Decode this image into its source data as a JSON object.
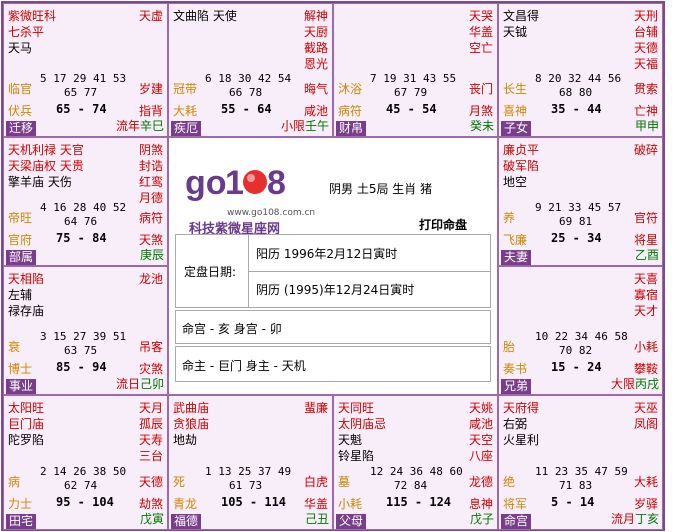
{
  "chart": {
    "title": "打印命盘",
    "gender_info": "阴男  土5局  生肖  猪",
    "site": "www.go108.com.cn",
    "brand": "科技紫微星座网",
    "logo_text": "go108",
    "date_label": "定盘日期:",
    "solar_date": "阳历  1996年2月12日寅时",
    "lunar_date": "阴历  (1995)年12月24日寅时",
    "ming_shen": "命宫 - 亥   身宫 - 卯",
    "zhu": "命主 - 巨门   身主 - 天机"
  },
  "cells": [
    {
      "id": "si",
      "left_stars": [
        "紫微旺科",
        "七杀平",
        "天马"
      ],
      "left_colors": [
        "red",
        "red",
        "blk"
      ],
      "right_stars": [
        "天虚"
      ],
      "nums1": "5 17 29 41 53",
      "nums2": "65 77",
      "stage": "临官",
      "right_label": "岁建",
      "god": "伏兵",
      "range": "65 - 74",
      "right_god": "指背",
      "branch_pre": "流年",
      "branch": "辛巳",
      "palace": "迁移"
    },
    {
      "id": "wu",
      "left_stars": [
        "文曲陷   天使"
      ],
      "left_colors": [
        "blk"
      ],
      "right_stars": [
        "解神",
        "天厨",
        "截路",
        "恩光"
      ],
      "nums1": "6 18 30 42 54",
      "nums2": "66 78",
      "stage": "冠带",
      "right_label": "晦气",
      "god": "大耗",
      "range": "55 - 64",
      "right_god": "咸池",
      "branch_pre": "小限",
      "branch": "壬午",
      "palace": "疾厄"
    },
    {
      "id": "wei",
      "left_stars": [],
      "left_colors": [],
      "right_stars": [
        "天哭",
        "华盖",
        "空亡"
      ],
      "nums1": "7 19 31 43 55",
      "nums2": "67 79",
      "stage": "沐浴",
      "right_label": "丧门",
      "god": "病符",
      "range": "45 - 54",
      "right_god": "月煞",
      "branch_pre": "",
      "branch": "癸未",
      "palace": "财帛"
    },
    {
      "id": "shen",
      "left_stars": [
        "文昌得",
        "天钺"
      ],
      "left_colors": [
        "blk",
        "blk"
      ],
      "right_stars": [
        "天刑",
        "台辅",
        "天德",
        "天福"
      ],
      "nums1": "8 20 32 44 56",
      "nums2": "68 80",
      "stage": "长生",
      "right_label": "贯索",
      "god": "喜神",
      "range": "35 - 44",
      "right_god": "亡神",
      "branch_pre": "",
      "branch": "甲申",
      "palace": "子女"
    },
    {
      "id": "chen",
      "left_stars": [
        "天机利禄  天官",
        "天梁庙权  天贵",
        "擎羊庙    天伤"
      ],
      "left_colors": [
        "red",
        "red",
        "blk"
      ],
      "right_stars": [
        "阴煞",
        "封诰",
        "红鸾",
        "月德"
      ],
      "nums1": "4 16 28 40 52",
      "nums2": "64 76",
      "stage": "帝旺",
      "right_label": "病符",
      "god": "官府",
      "range": "75 - 84",
      "right_god": "天煞",
      "branch_pre": "",
      "branch": "庚辰",
      "palace": "部属"
    },
    {
      "id": "you",
      "left_stars": [
        "廉贞平",
        "破军陷",
        "地空"
      ],
      "left_colors": [
        "red",
        "red",
        "blk"
      ],
      "right_stars": [
        "破碎"
      ],
      "nums1": "9 21 33 45 57",
      "nums2": "69 81",
      "stage": "养",
      "right_label": "官符",
      "god": "飞廉",
      "range": "25 - 34",
      "right_god": "将星",
      "branch_pre": "",
      "branch": "乙酉",
      "palace": "夫妻"
    },
    {
      "id": "mao",
      "left_stars": [
        "天相陷",
        "左辅",
        "禄存庙"
      ],
      "left_colors": [
        "red",
        "blk",
        "blk"
      ],
      "right_stars": [
        "龙池"
      ],
      "nums1": "3 15 27 39 51",
      "nums2": "63 75",
      "stage": "衰",
      "right_label": "吊客",
      "god": "博士",
      "range": "85 - 94",
      "right_god": "灾煞",
      "branch_pre": "流日",
      "branch": "己卯",
      "palace": "事业"
    },
    {
      "id": "xu",
      "left_stars": [],
      "left_colors": [],
      "right_stars": [
        "天喜",
        "寡宿",
        "天才"
      ],
      "nums1": "10 22 34 46 58",
      "nums2": "70 82",
      "stage": "胎",
      "right_label": "小耗",
      "god": "奏书",
      "range": "15 - 24",
      "right_god": "攀鞍",
      "branch_pre": "大限",
      "branch": "丙戌",
      "palace": "兄弟"
    },
    {
      "id": "yin",
      "left_stars": [
        "太阳旺",
        "巨门庙",
        "陀罗陷"
      ],
      "left_colors": [
        "red",
        "red",
        "blk"
      ],
      "right_stars": [
        "天月",
        "孤辰",
        "天寿",
        "三台"
      ],
      "nums1": "2 14 26 38 50",
      "nums2": "62 74",
      "stage": "病",
      "right_label": "天德",
      "god": "力士",
      "range": "95 - 104",
      "right_god": "劫煞",
      "branch_pre": "",
      "branch": "戊寅",
      "palace": "田宅"
    },
    {
      "id": "chou",
      "left_stars": [
        "武曲庙",
        "贪狼庙",
        "地劫"
      ],
      "left_colors": [
        "red",
        "red",
        "blk"
      ],
      "right_stars": [
        "蜚廉"
      ],
      "nums1": "1 13 25 37 49",
      "nums2": "61 73",
      "stage": "死",
      "right_label": "白虎",
      "god": "青龙",
      "range": "105 - 114",
      "right_god": "华盖",
      "branch_pre": "",
      "branch": "己丑",
      "palace": "福德"
    },
    {
      "id": "zi",
      "left_stars": [
        "天同旺",
        "太阴庙忌",
        "天魁",
        "铃星陷"
      ],
      "left_colors": [
        "red",
        "red",
        "blk",
        "blk"
      ],
      "right_stars": [
        "天姚",
        "咸池",
        "天空",
        "八座"
      ],
      "nums1": "12 24 36 48 60",
      "nums2": "72 84",
      "stage": "墓",
      "right_label": "龙德",
      "god": "小耗",
      "range": "115 - 124",
      "right_god": "息神",
      "branch_pre": "",
      "branch": "戊子",
      "palace": "父母"
    },
    {
      "id": "hai",
      "left_stars": [
        "天府得",
        "右弼",
        "火星利"
      ],
      "left_colors": [
        "red",
        "blk",
        "blk"
      ],
      "right_stars": [
        "天巫",
        "凤阁"
      ],
      "nums1": "11 23 35 47 59",
      "nums2": "71 83",
      "stage": "绝",
      "right_label": "大耗",
      "god": "将军",
      "range": "5 - 14",
      "right_god": "岁驿",
      "branch_pre": "流月",
      "branch": "丁亥",
      "palace": "命宫"
    }
  ]
}
